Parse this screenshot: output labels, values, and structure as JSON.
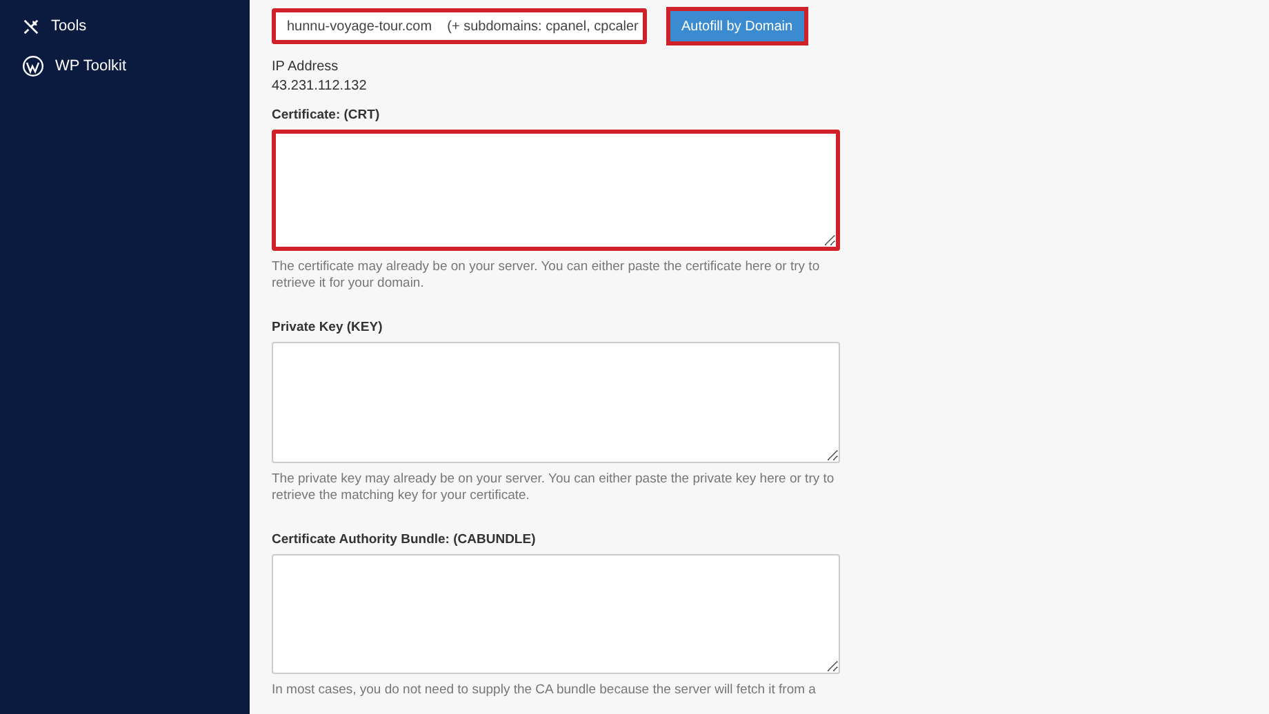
{
  "sidebar": {
    "items": [
      {
        "kind": "tools",
        "label": "Tools"
      },
      {
        "kind": "wordpress",
        "label": "WP Toolkit"
      }
    ]
  },
  "domain": {
    "value": "hunnu-voyage-tour.com    (+ subdomains: cpanel, cpcaler",
    "highlighted": true
  },
  "autofill_button": {
    "label": "Autofill by Domain",
    "highlighted": true
  },
  "ip": {
    "label": "IP Address",
    "value": "43.231.112.132"
  },
  "fields": [
    {
      "label": "Certificate: (CRT)",
      "help": "The certificate may already be on your server. You can either paste the certificate here or try to retrieve it for your domain.",
      "highlighted": true
    },
    {
      "label": "Private Key (KEY)",
      "help": "The private key may already be on your server. You can either paste the private key here or try to retrieve the matching key for your certificate.",
      "highlighted": false
    },
    {
      "label": "Certificate Authority Bundle: (CABUNDLE)",
      "help": "In most cases, you do not need to supply the CA bundle because the server will fetch it from a",
      "highlighted": false
    }
  ]
}
